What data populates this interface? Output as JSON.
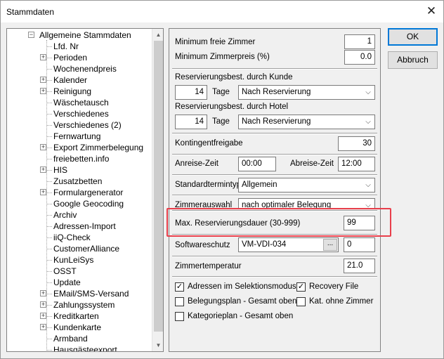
{
  "window": {
    "title": "Stammdaten",
    "close_glyph": "✕"
  },
  "tree": {
    "root_label": "Allgemeine Stammdaten",
    "items": [
      {
        "label": "Lfd. Nr",
        "expandable": false
      },
      {
        "label": "Perioden",
        "expandable": true
      },
      {
        "label": "Wochenendpreis",
        "expandable": false
      },
      {
        "label": "Kalender",
        "expandable": true
      },
      {
        "label": "Reinigung",
        "expandable": true
      },
      {
        "label": "Wäschetausch",
        "expandable": false
      },
      {
        "label": "Verschiedenes",
        "expandable": false
      },
      {
        "label": "Verschiedenes (2)",
        "expandable": false
      },
      {
        "label": "Fernwartung",
        "expandable": false
      },
      {
        "label": "Export Zimmerbelegung",
        "expandable": true
      },
      {
        "label": "freiebetten.info",
        "expandable": false
      },
      {
        "label": "HIS",
        "expandable": true
      },
      {
        "label": "Zusatzbetten",
        "expandable": false
      },
      {
        "label": "Formulargenerator",
        "expandable": true
      },
      {
        "label": "Google Geocoding",
        "expandable": false
      },
      {
        "label": "Archiv",
        "expandable": false
      },
      {
        "label": "Adressen-Import",
        "expandable": false
      },
      {
        "label": "iiQ-Check",
        "expandable": false
      },
      {
        "label": "CustomerAlliance",
        "expandable": false
      },
      {
        "label": "KunLeiSys",
        "expandable": false
      },
      {
        "label": "OSST",
        "expandable": false
      },
      {
        "label": "Update",
        "expandable": false
      },
      {
        "label": "EMail/SMS-Versand",
        "expandable": true
      },
      {
        "label": "Zahlungssystem",
        "expandable": true
      },
      {
        "label": "Kreditkarten",
        "expandable": true
      },
      {
        "label": "Kundenkarte",
        "expandable": true
      },
      {
        "label": "Armband",
        "expandable": false
      },
      {
        "label": "Hausgästeexport",
        "expandable": false
      }
    ]
  },
  "form": {
    "min_free_rooms": {
      "label": "Minimum freie Zimmer",
      "value": "1"
    },
    "min_room_price": {
      "label": "Minimum Zimmerpreis (%)",
      "value": "0.0"
    },
    "res_confirm_customer": {
      "label": "Reservierungsbest. durch Kunde",
      "days": "14",
      "days_unit": "Tage",
      "option": "Nach Reservierung"
    },
    "res_confirm_hotel": {
      "label": "Reservierungsbest. durch Hotel",
      "days": "14",
      "days_unit": "Tage",
      "option": "Nach Reservierung"
    },
    "quota_release": {
      "label": "Kontingentfreigabe",
      "value": "30"
    },
    "arrival_time": {
      "label": "Anreise-Zeit",
      "value": "00:00"
    },
    "departure_time": {
      "label": "Abreise-Zeit",
      "value": "12:00"
    },
    "default_date_type": {
      "label": "Standardtermintyp",
      "value": "Allgemein"
    },
    "room_selection": {
      "label": "Zimmerauswahl",
      "value": "nach optimaler Belegung"
    },
    "max_res_duration": {
      "label": "Max. Reservierungsdauer (30-999)",
      "value": "99"
    },
    "software_protection": {
      "label": "Softwareschutz",
      "value": "VM-VDI-034",
      "button": "...",
      "number": "0"
    },
    "room_temperature": {
      "label": "Zimmertemperatur",
      "value": "21.0"
    },
    "checkboxes": [
      {
        "label": "Adressen im Selektionsmodus",
        "checked": true
      },
      {
        "label": "Recovery File",
        "checked": true
      },
      {
        "label": "Belegungsplan - Gesamt oben",
        "checked": false
      },
      {
        "label": "Kat. ohne Zimmer",
        "checked": false
      },
      {
        "label": "Kategorieplan - Gesamt oben",
        "checked": false
      }
    ]
  },
  "buttons": {
    "ok": "OK",
    "cancel": "Abbruch"
  },
  "colors": {
    "highlight": "#e83f4b",
    "default_button_border": "#0078d7"
  }
}
